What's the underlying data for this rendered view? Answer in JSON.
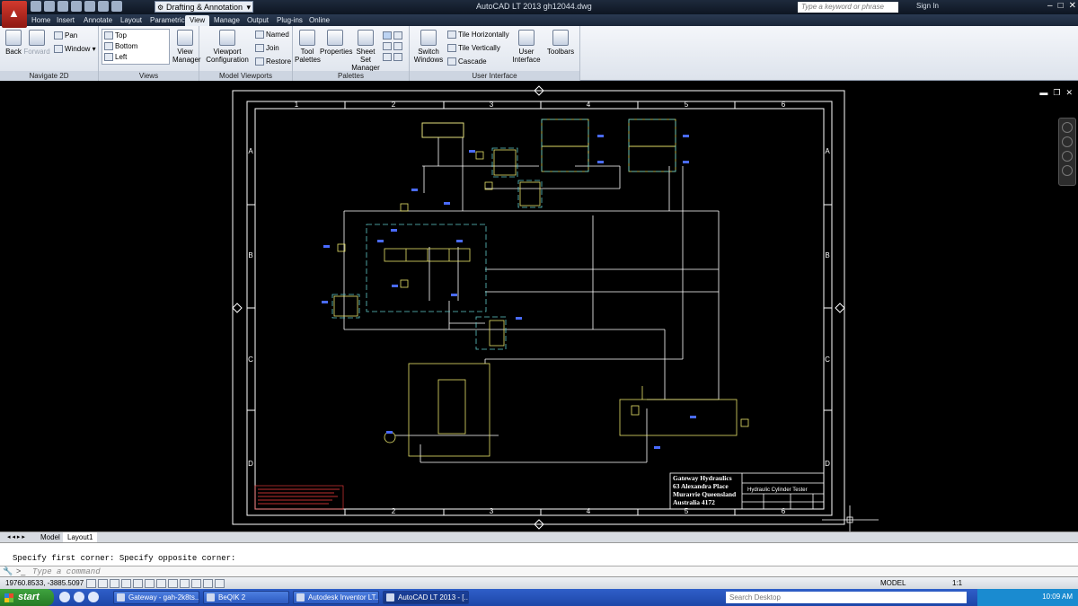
{
  "window": {
    "title": "AutoCAD LT 2013    gh12044.dwg",
    "workspace": "Drafting & Annotation",
    "search_placeholder": "Type a keyword or phrase",
    "sign_in": "Sign In",
    "controls": [
      "–",
      "□",
      "✕"
    ]
  },
  "ribbon_tabs": [
    "Home",
    "Insert",
    "Annotate",
    "Layout",
    "Parametric",
    "View",
    "Manage",
    "Output",
    "Plug-ins",
    "Online"
  ],
  "active_tab": "View",
  "ribbon": {
    "navigate": {
      "label": "Navigate 2D",
      "back": "Back",
      "forward": "Forward",
      "pan": "Pan",
      "window": "Window"
    },
    "views": {
      "label": "Views",
      "items": [
        "Top",
        "Bottom",
        "Left"
      ],
      "view_manager": "View Manager"
    },
    "model_viewports": {
      "label": "Model Viewports",
      "config": "Viewport Configuration",
      "named": "Named",
      "join": "Join",
      "restore": "Restore"
    },
    "palettes": {
      "label": "Palettes",
      "tool": "Tool Palettes",
      "properties": "Properties",
      "sheet_set": "Sheet Set Manager"
    },
    "user_interface": {
      "label": "User Interface",
      "switch": "Switch Windows",
      "tile_h": "Tile Horizontally",
      "tile_v": "Tile Vertically",
      "cascade": "Cascade",
      "user_interface": "User Interface",
      "toolbars": "Toolbars"
    }
  },
  "drawing": {
    "grid_cols": [
      "1",
      "2",
      "3",
      "4",
      "5",
      "6"
    ],
    "grid_rows": [
      "A",
      "B",
      "C",
      "D"
    ],
    "title_block": {
      "company": [
        "Gateway Hydraulics",
        "63 Alexandra Place",
        "Murarrie Queensland",
        "Australia 4172"
      ],
      "title": "Hydraulic Cylinder Tester"
    }
  },
  "layout_tabs": [
    "Model",
    "Layout1"
  ],
  "active_layout": "Layout1",
  "command": {
    "history": "Specify first corner: Specify opposite corner:",
    "placeholder": "Type a command"
  },
  "status": {
    "coordinates": "19760.8533, -3885.5097",
    "model": "MODEL",
    "scale": "1:1"
  },
  "taskbar": {
    "start": "start",
    "tasks": [
      "Gateway - gah-2k8ts...",
      "BeQIK 2",
      "Autodesk Inventor LT...",
      "AutoCAD LT 2013 - [..."
    ],
    "search": "Search Desktop",
    "time": "10:09 AM"
  }
}
